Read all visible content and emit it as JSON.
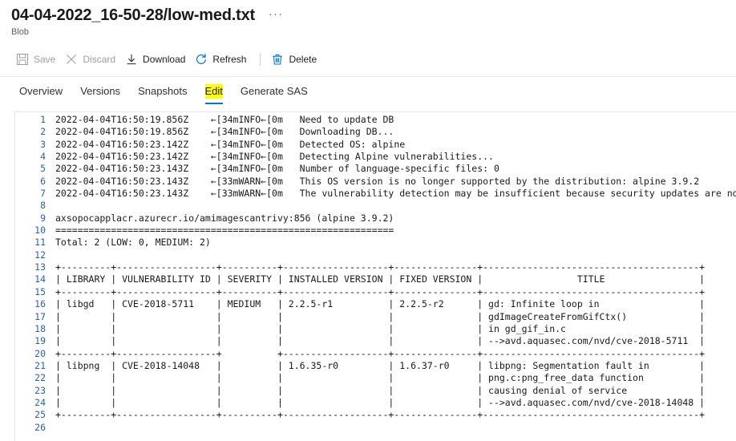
{
  "header": {
    "title": "04-04-2022_16-50-28/low-med.txt",
    "ellipsis": "···",
    "subtitle": "Blob"
  },
  "toolbar": {
    "items": [
      {
        "label": "Save",
        "icon": "save-icon",
        "enabled": false
      },
      {
        "label": "Discard",
        "icon": "discard-icon",
        "enabled": false
      },
      {
        "label": "Download",
        "icon": "download-icon",
        "enabled": true
      },
      {
        "label": "Refresh",
        "icon": "refresh-icon",
        "enabled": true
      },
      {
        "label": "Delete",
        "icon": "delete-icon",
        "enabled": true
      }
    ]
  },
  "tabs": {
    "items": [
      {
        "label": "Overview",
        "selected": false
      },
      {
        "label": "Versions",
        "selected": false
      },
      {
        "label": "Snapshots",
        "selected": false
      },
      {
        "label": "Edit",
        "selected": true
      },
      {
        "label": "Generate SAS",
        "selected": false
      }
    ],
    "selected_highlight_color": "#ffff00",
    "selected_underline_color": "#0078d4"
  },
  "editor": {
    "line_number_color": "#2b5fb8",
    "lines": [
      {
        "n": "1",
        "text": "2022-04-04T16:50:19.856Z    ←[34mINFO←[0m   Need to update DB"
      },
      {
        "n": "2",
        "text": "2022-04-04T16:50:19.856Z    ←[34mINFO←[0m   Downloading DB..."
      },
      {
        "n": "3",
        "text": "2022-04-04T16:50:23.142Z    ←[34mINFO←[0m   Detected OS: alpine"
      },
      {
        "n": "4",
        "text": "2022-04-04T16:50:23.142Z    ←[34mINFO←[0m   Detecting Alpine vulnerabilities..."
      },
      {
        "n": "5",
        "text": "2022-04-04T16:50:23.143Z    ←[34mINFO←[0m   Number of language-specific files: 0"
      },
      {
        "n": "6",
        "text": "2022-04-04T16:50:23.143Z    ←[33mWARN←[0m   This OS version is no longer supported by the distribution: alpine 3.9.2"
      },
      {
        "n": "7",
        "text": "2022-04-04T16:50:23.143Z    ←[33mWARN←[0m   The vulnerability detection may be insufficient because security updates are not provided"
      },
      {
        "n": "8",
        "text": ""
      },
      {
        "n": "9",
        "text": "axsopocapplacr.azurecr.io/amimagescantrivy:856 (alpine 3.9.2)"
      },
      {
        "n": "10",
        "text": "============================================================="
      },
      {
        "n": "11",
        "text": "Total: 2 (LOW: 0, MEDIUM: 2)"
      },
      {
        "n": "12",
        "text": ""
      },
      {
        "n": "13",
        "text": "+---------+------------------+----------+-------------------+---------------+---------------------------------------+"
      },
      {
        "n": "14",
        "text": "| LIBRARY | VULNERABILITY ID | SEVERITY | INSTALLED VERSION | FIXED VERSION |                 TITLE                 |"
      },
      {
        "n": "15",
        "text": "+---------+------------------+----------+-------------------+---------------+---------------------------------------+"
      },
      {
        "n": "16",
        "text": "| libgd   | CVE-2018-5711    | MEDIUM   | 2.2.5-r1          | 2.2.5-r2      | gd: Infinite loop in                  |"
      },
      {
        "n": "17",
        "text": "|         |                  |          |                   |               | gdImageCreateFromGifCtx()             |"
      },
      {
        "n": "18",
        "text": "|         |                  |          |                   |               | in gd_gif_in.c                        |"
      },
      {
        "n": "19",
        "text": "|         |                  |          |                   |               | -->avd.aquasec.com/nvd/cve-2018-5711  |"
      },
      {
        "n": "20",
        "text": "+---------+------------------+          +-------------------+---------------+---------------------------------------+"
      },
      {
        "n": "21",
        "text": "| libpng  | CVE-2018-14048   |          | 1.6.35-r0         | 1.6.37-r0     | libpng: Segmentation fault in         |"
      },
      {
        "n": "22",
        "text": "|         |                  |          |                   |               | png.c:png_free_data function          |"
      },
      {
        "n": "23",
        "text": "|         |                  |          |                   |               | causing denial of service             |"
      },
      {
        "n": "24",
        "text": "|         |                  |          |                   |               | -->avd.aquasec.com/nvd/cve-2018-14048 |"
      },
      {
        "n": "25",
        "text": "+---------+------------------+----------+-------------------+---------------+---------------------------------------+"
      },
      {
        "n": "26",
        "text": ""
      }
    ]
  }
}
